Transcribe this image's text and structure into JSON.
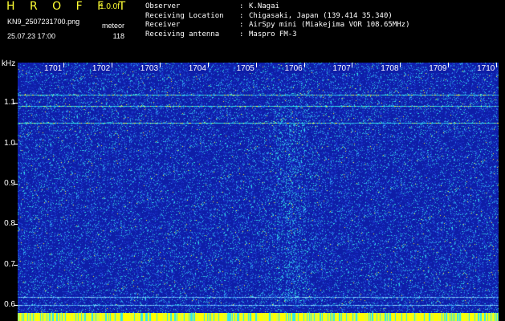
{
  "header": {
    "app_title": "H R O F F T",
    "version": "1.0.0f",
    "file_name": "KN9_2507231700.png",
    "datetime": "25.07.23 17:00",
    "mode": "meteor",
    "count": "118",
    "info": [
      {
        "key": "Observer",
        "value": "K.Nagai"
      },
      {
        "key": "Receiving Location",
        "value": "Chigasaki, Japan (139.414 35.340)"
      },
      {
        "key": "Receiver",
        "value": "AirSpy mini (Miakejima VOR 108.65MHz)"
      },
      {
        "key": "Receiving antenna",
        "value": "Maspro FM-3"
      }
    ]
  },
  "chart_data": {
    "type": "heatmap",
    "x_unit": "",
    "y_unit": "kHz",
    "x_ticks": [
      "1701",
      "1702",
      "1703",
      "1704",
      "1705",
      "1706",
      "1707",
      "1708",
      "1709",
      "1710"
    ],
    "y_ticks": [
      "1.1",
      "1.0",
      "0.9",
      "0.8",
      "0.7",
      "0.6"
    ],
    "ylim": [
      0.58,
      1.2
    ],
    "colors": {
      "background": "#0e1ea8",
      "noise_low": "#1f3bd6",
      "noise_mid": "#2f8ff0",
      "noise_high": "#33e6e6",
      "hot": "#ffff33",
      "bottom_bar": "#ffff00"
    }
  }
}
